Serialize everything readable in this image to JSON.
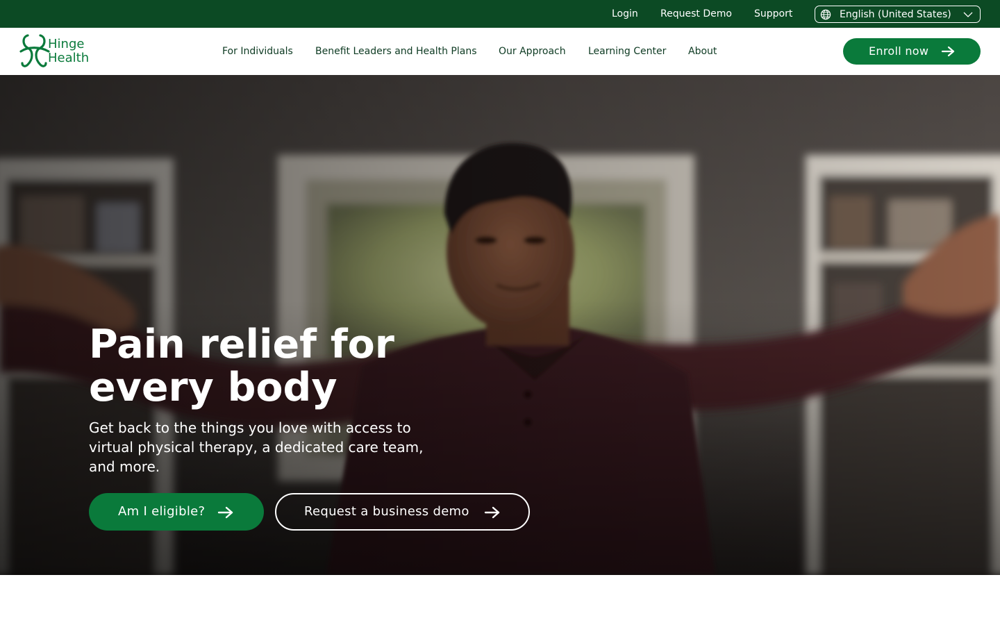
{
  "utility_bar": {
    "login": "Login",
    "request_demo": "Request Demo",
    "support": "Support",
    "language": {
      "selected": "English (United States)",
      "icon": "globe-icon",
      "chevron": "chevron-down-icon"
    }
  },
  "header": {
    "logo": {
      "line1": "Hinge",
      "line2": "Health"
    },
    "nav": [
      {
        "label": "For Individuals"
      },
      {
        "label": "Benefit Leaders and Health Plans"
      },
      {
        "label": "Our Approach"
      },
      {
        "label": "Learning Center"
      },
      {
        "label": "About"
      }
    ],
    "enroll": {
      "label": "Enroll now",
      "icon": "arrow-right-icon"
    }
  },
  "hero": {
    "headline_line1": "Pain relief for",
    "headline_line2": "every body",
    "subtext": "Get back to the things you love with access to virtual physical therapy, a dedicated care team, and more.",
    "primary_cta": {
      "label": "Am I eligible?",
      "icon": "arrow-right-icon"
    },
    "secondary_cta": {
      "label": "Request a business demo",
      "icon": "arrow-right-icon"
    }
  },
  "colors": {
    "utility_bar_bg": "#0c4a24",
    "brand_green": "#0a7a3b",
    "nav_text": "#0d3a22",
    "white": "#ffffff"
  }
}
